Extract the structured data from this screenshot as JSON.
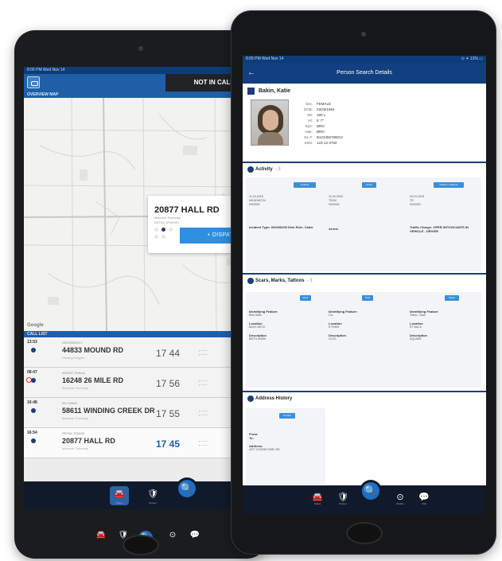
{
  "back_app": {
    "status_time": "8:05 PM  Wed Nov 14",
    "call_state": "NOT IN CALL",
    "map_section": "OVERVIEW MAP",
    "map_attribution": "Google",
    "popup": {
      "address": "20877 HALL RD",
      "detail": "Macomb Township",
      "line2": "DETAIL (PHASE)",
      "dispatch": "+ DISPATCH"
    },
    "call_list_label": "CALL LIST",
    "calls": [
      {
        "time": "13:53",
        "tiny": "DISORDERLY",
        "road": "44833 MOUND RD",
        "sub": "Sterling Heights",
        "eta": "17 44",
        "highlight": false
      },
      {
        "time": "08:47",
        "tiny": "ASSIST (Police)",
        "road": "16248 26 MILE RD",
        "sub": "Macomb Township",
        "eta": "17 56",
        "highlight": false
      },
      {
        "time": "16:48",
        "tiny": "911 HANG",
        "road": "58611 WINDING CREEK DR",
        "sub": "Macomb Township",
        "eta": "17 55",
        "highlight": false
      },
      {
        "time": "16:54",
        "tiny": "RETAIL FRAUD",
        "road": "20877 HALL RD",
        "sub": "Macomb Township",
        "eta": "17 45",
        "highlight": true
      }
    ],
    "tabs": [
      {
        "icon": "car-icon",
        "glyph": "🚘",
        "label": "Status"
      },
      {
        "icon": "shield-icon",
        "glyph": "🛡",
        "label": "Person"
      },
      {
        "icon": "search-icon",
        "glyph": "🔍",
        "label": "Search"
      },
      {
        "icon": "target-icon",
        "glyph": "⊙",
        "label": "Radius"
      }
    ]
  },
  "front_app": {
    "status_left": "8:05 PM  Wed Nov 14",
    "status_right": "⊙ ✦ 13% ▭",
    "header_title": "Person Search Details",
    "back_glyph": "←",
    "person": {
      "name": "Bakin, Katie",
      "fields": [
        {
          "k": "Sex:",
          "v": "FEMALE"
        },
        {
          "k": "DOB:",
          "v": "03/20/1964"
        },
        {
          "k": "Wt:",
          "v": "180 L"
        },
        {
          "k": "Ht:",
          "v": "5' 7\""
        },
        {
          "k": "Eye:",
          "v": "BRO"
        },
        {
          "k": "Hair:",
          "v": "BRO"
        },
        {
          "k": "DL #:",
          "v": "B123456789012"
        },
        {
          "k": "SSN:",
          "v": "123-12-3750"
        }
      ]
    },
    "activity": {
      "title": "Activity",
      "count": "- 3",
      "buttons": [
        "Incident",
        "Arrest",
        "Citation / Address"
      ],
      "rows": [
        [
          "11-04-2018",
          "11-04-2018",
          "09-04-2018"
        ],
        [
          "MS18160734",
          "TSKM",
          "TR"
        ],
        [
          "0000000",
          "0000000",
          "0000000"
        ],
        [
          "Incident Type: 0000/00/00 Disk Role: Caller",
          "Arrest",
          "Traffic Charge: OPER INTOXICANTS IN VEHICLE - DRIVER"
        ]
      ]
    },
    "scars": {
      "title": "Scars, Marks, Tattoos",
      "count": "- 3",
      "buttons": [
        "Mark",
        "Scar",
        "Tattoo"
      ],
      "cols": [
        {
          "feature_k": "Identifying Feature",
          "feature": "Birth Mark",
          "loc_k": "Location",
          "loc": "BACK NECK",
          "desc_k": "Description",
          "desc": "BIRTH MARK"
        },
        {
          "feature_k": "Identifying Feature",
          "feature": "Cut",
          "loc_k": "Location",
          "loc": "R FARM",
          "desc_k": "Description",
          "desc": "CUTS"
        },
        {
          "feature_k": "Identifying Feature",
          "feature": "Tattoo - back",
          "loc_k": "Location",
          "loc": "RT BACK",
          "desc_k": "Description",
          "desc": "SQUARE"
        }
      ]
    },
    "address": {
      "title": "Address History",
      "button": "Current",
      "from_k": "From:",
      "to_k": "To:",
      "addr_k": "Address:",
      "addr": "4377 CODDIE PARK RD"
    },
    "tabs": [
      {
        "icon": "car-icon",
        "glyph": "🚘",
        "label": "Status"
      },
      {
        "icon": "shield-icon",
        "glyph": "🛡",
        "label": "Person"
      },
      {
        "icon": "search-icon",
        "glyph": "🔍",
        "label": ""
      },
      {
        "icon": "target-icon",
        "glyph": "⊙",
        "label": "Radius"
      },
      {
        "icon": "chat-icon",
        "glyph": "💬",
        "label": "Chat"
      }
    ]
  },
  "colors": {
    "header_blue": "#1f5fa8",
    "dark_navy": "#111a2b",
    "accent_button": "#2f8fe0"
  }
}
